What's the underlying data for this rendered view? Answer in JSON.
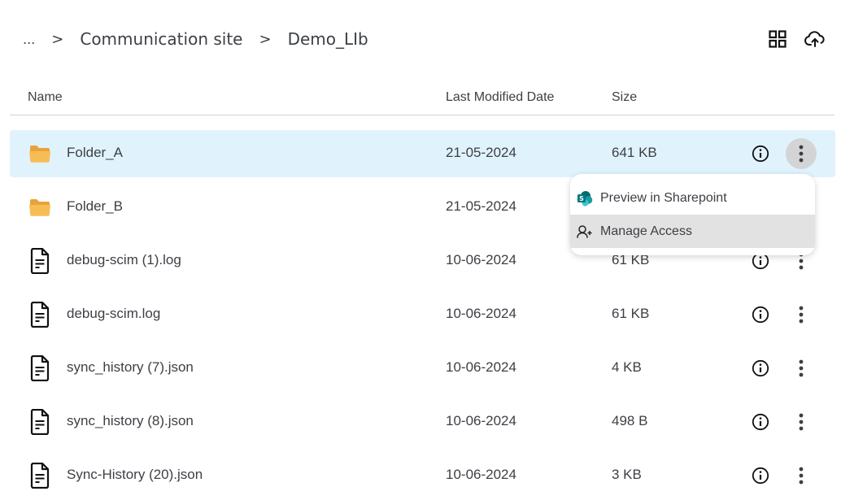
{
  "breadcrumb": {
    "ellipsis": "...",
    "separator": ">",
    "items": [
      "Communication site",
      "Demo_LIb"
    ]
  },
  "toolbar": {
    "grid_view_icon": "grid-icon",
    "upload_icon": "cloud-upload-icon"
  },
  "table": {
    "headers": {
      "name": "Name",
      "date": "Last Modified Date",
      "size": "Size"
    },
    "rows": [
      {
        "type": "folder",
        "name": "Folder_A",
        "date": "21-05-2024",
        "size": "641 KB",
        "selected": true
      },
      {
        "type": "folder",
        "name": "Folder_B",
        "date": "21-05-2024",
        "size": ""
      },
      {
        "type": "file",
        "name": "debug-scim (1).log",
        "date": "10-06-2024",
        "size": "61 KB"
      },
      {
        "type": "file",
        "name": "debug-scim.log",
        "date": "10-06-2024",
        "size": "61 KB"
      },
      {
        "type": "file",
        "name": "sync_history (7).json",
        "date": "10-06-2024",
        "size": "4 KB"
      },
      {
        "type": "file",
        "name": "sync_history (8).json",
        "date": "10-06-2024",
        "size": "498 B"
      },
      {
        "type": "file",
        "name": "Sync-History (20).json",
        "date": "10-06-2024",
        "size": "3 KB"
      }
    ]
  },
  "context_menu": {
    "items": [
      {
        "label": "Preview in Sharepoint",
        "icon": "sharepoint-icon"
      },
      {
        "label": "Manage Access",
        "icon": "person-add-icon",
        "hovered": true
      }
    ]
  },
  "colors": {
    "selected_row": "#e0f3fd",
    "folder": "#f5b84c",
    "sharepoint": "#0b8a8f",
    "menu_hover": "#e2e2e2"
  }
}
